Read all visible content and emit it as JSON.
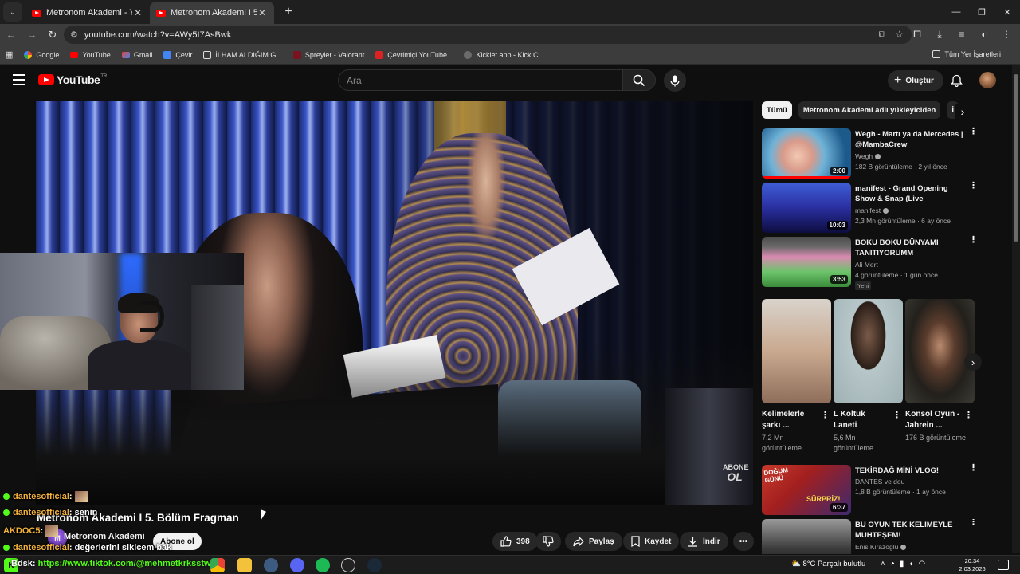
{
  "browser": {
    "tabs": [
      {
        "label": "Metronom Akademi - YouTube",
        "active": false
      },
      {
        "label": "Metronom Akademi I 5. Bölüm",
        "active": true
      }
    ],
    "url": "youtube.com/watch?v=AWy5I7AsBwk",
    "bookmarks": [
      "Google",
      "YouTube",
      "Gmail",
      "Çevir",
      "İLHAM ALDIĞIM G...",
      "Spreyler - Valorant",
      "Çevrimiçi YouTube...",
      "Kicklet.app - Kick C..."
    ],
    "bookmarks_all": "Tüm Yer İşaretleri"
  },
  "youtube": {
    "logo": "YouTube",
    "logo_region": "TR",
    "search_placeholder": "Ara",
    "create_label": "Oluştur"
  },
  "video": {
    "title": "Metronom Akademi I 5. Bölüm Fragman",
    "channel": "Metronom Akademi",
    "subscribe_label": "Abone ol",
    "likes": "398",
    "share_label": "Paylaş",
    "save_label": "Kaydet",
    "download_label": "İndir",
    "watermark_top": "ABONE",
    "watermark_bottom": "OL"
  },
  "stream_overlay": {
    "chat": [
      {
        "user": "dantesofficial",
        "message": ":"
      },
      {
        "user": "dantesofficial",
        "message": ": senin"
      },
      {
        "user": "AKDOC5",
        "message": ":"
      },
      {
        "user": "dantesofficial",
        "message": ": değerlerini sikicem bak"
      }
    ],
    "ticker_prefix": "Bdsk: ",
    "ticker_url": "https://www.tiktok.com/@mehmetkrksstw"
  },
  "sidebar": {
    "chips": [
      "Tümü",
      "Metronom Akademi adlı yükleyiciden",
      "İ"
    ],
    "videos": [
      {
        "title": "Wegh - Martı ya da Mercedes | @MambaCrew",
        "channel": "Wegh",
        "verified": true,
        "meta": "182 B görüntüleme · 2 yıl önce",
        "duration": "2:00",
        "progress": 1.0,
        "badge": ""
      },
      {
        "title": "manifest - Grand Opening Show & Snap (Live Performance) ...",
        "channel": "manifest",
        "verified": true,
        "meta": "2,3 Mn görüntüleme · 6 ay önce",
        "duration": "10:03",
        "progress": 0,
        "badge": ""
      },
      {
        "title": "BOKU BOKU DÜNYAMI TANITIYORUMM",
        "channel": "Ali Mert",
        "verified": false,
        "meta": "4 görüntüleme · 1 gün önce",
        "duration": "3:53",
        "progress": 0,
        "badge": "Yeni"
      },
      {
        "title": "TEKİRDAĞ MİNİ VLOG!",
        "channel": "DANTES ve dou",
        "verified": false,
        "meta": "1,8 B görüntüleme · 1 ay önce",
        "duration": "6:37",
        "progress": 0,
        "badge": ""
      },
      {
        "title": "BU OYUN TEK KELİMEYLE MUHTEŞEM!",
        "channel": "Enis Kirazoğlu",
        "verified": true,
        "meta": "",
        "duration": "",
        "progress": 0,
        "badge": ""
      }
    ],
    "shorts": [
      {
        "title": "Kelimelerle şarkı ...",
        "views": "7,2 Mn görüntüleme"
      },
      {
        "title": "L Koltuk Laneti",
        "views": "5,6 Mn görüntüleme"
      },
      {
        "title": "Konsol Oyun - Jahrein ...",
        "views": "176 B görüntüleme"
      }
    ],
    "thumb_texts": {
      "v4_a": "DOĞUM",
      "v4_b": "GÜNÜ",
      "v4_c": "SÜRPRİZ!"
    }
  },
  "taskbar": {
    "weather": "8°C  Parçalı bulutlu",
    "time": "20:34",
    "date": "2.03.2026"
  },
  "colors": {
    "accent": "#ff0000",
    "kick_green": "#53fc18",
    "chat_user": "#f5b33b"
  }
}
